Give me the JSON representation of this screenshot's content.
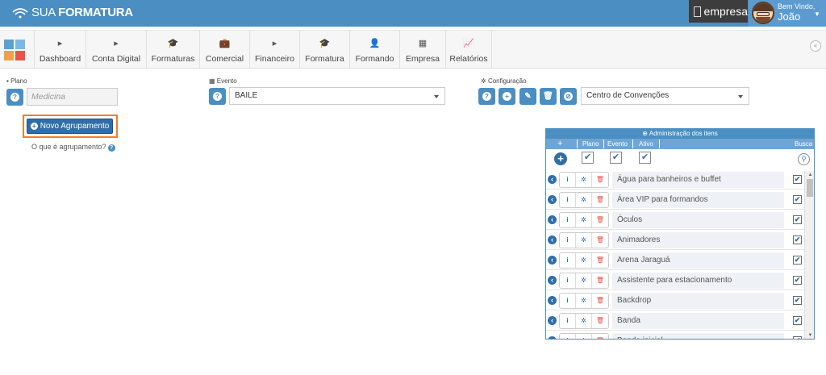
{
  "brand": {
    "name_part1": "SUA",
    "name_part2": "FORMATURA"
  },
  "header": {
    "company": "empresa",
    "welcome": "Bem Vindo,",
    "username": "João"
  },
  "nav": {
    "items": [
      {
        "label": "Dashboard",
        "icon": "caret-right-icon",
        "glyph": "▸"
      },
      {
        "label": "Conta Digital",
        "icon": "caret-right-icon",
        "glyph": "▸"
      },
      {
        "label": "Formaturas",
        "icon": "graduation-cap-icon",
        "glyph": "🎓"
      },
      {
        "label": "Comercial",
        "icon": "briefcase-icon",
        "glyph": "💼"
      },
      {
        "label": "Financeiro",
        "icon": "caret-right-icon",
        "glyph": "▸"
      },
      {
        "label": "Formatura",
        "icon": "graduation-cap-icon",
        "glyph": "🎓"
      },
      {
        "label": "Formando",
        "icon": "user-icon",
        "glyph": "👤"
      },
      {
        "label": "Empresa",
        "icon": "building-icon",
        "glyph": "▦"
      },
      {
        "label": "Relatórios",
        "icon": "line-chart-icon",
        "glyph": "📈"
      }
    ]
  },
  "form": {
    "plano_label": "Plano",
    "plano_placeholder": "Medicina",
    "evento_label": "Evento",
    "evento_value": "BAILE",
    "config_label": "Configuração",
    "config_value": "Centro de Convenções"
  },
  "actions": {
    "novo_label": "Novo Agrupamento",
    "help_text": "O que é agrupamento?"
  },
  "panel": {
    "title": "Administração dos itens",
    "col_plano": "Plano",
    "col_evento": "Evento",
    "col_ativo": "Ativo",
    "col_busca": "Busca",
    "items": [
      {
        "name": "Água para banheiros e buffet",
        "checked": true
      },
      {
        "name": "Área VIP para formandos",
        "checked": true
      },
      {
        "name": "Óculos",
        "checked": true
      },
      {
        "name": "Animadores",
        "checked": true
      },
      {
        "name": "Arena Jaraguá",
        "checked": true
      },
      {
        "name": "Assistente para estacionamento",
        "checked": true
      },
      {
        "name": "Backdrop",
        "checked": true
      },
      {
        "name": "Banda",
        "checked": true
      },
      {
        "name": "Banda inicial",
        "checked": true
      }
    ]
  },
  "colors": {
    "primary": "#4a8ec2",
    "dark_primary": "#2f6ea8",
    "highlight": "#f07f2a",
    "danger": "#e8534a"
  }
}
